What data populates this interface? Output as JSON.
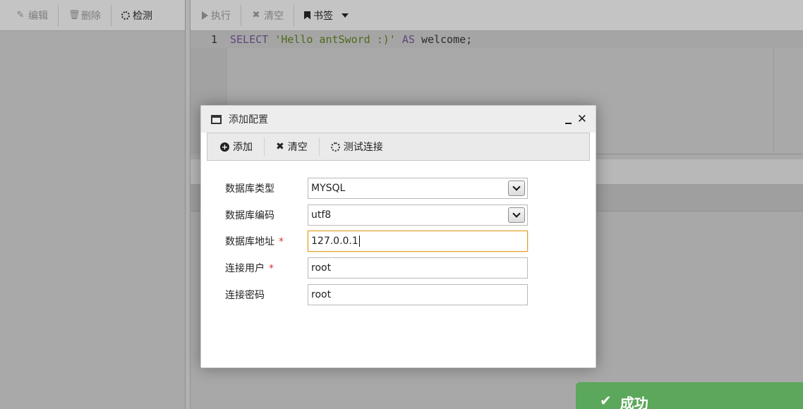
{
  "left_toolbar": {
    "edit_label": "编辑",
    "delete_label": "删除",
    "detect_label": "检测"
  },
  "right_toolbar": {
    "execute_label": "执行",
    "clear_label": "清空",
    "bookmark_label": "书签"
  },
  "editor": {
    "line_number": "1",
    "code": {
      "kw_select": "SELECT",
      "string": "'Hello antSword :)'",
      "kw_as": "AS",
      "ident": "welcome;"
    }
  },
  "dialog": {
    "title": "添加配置",
    "toolbar": {
      "add_label": "添加",
      "clear_label": "清空",
      "test_label": "测试连接"
    },
    "fields": {
      "db_type": {
        "label": "数据库类型",
        "value": "MYSQL"
      },
      "db_encoding": {
        "label": "数据库编码",
        "value": "utf8"
      },
      "db_host": {
        "label": "数据库地址",
        "value": "127.0.0.1",
        "required": "*"
      },
      "db_user": {
        "label": "连接用户",
        "value": "root",
        "required": "*"
      },
      "db_pass": {
        "label": "连接密码",
        "value": "root"
      }
    }
  },
  "toast": {
    "check": "✔",
    "text": "成功"
  },
  "colors": {
    "toast_bg": "#5ba75b",
    "focus_border": "#e0a026",
    "required": "#d33333"
  }
}
